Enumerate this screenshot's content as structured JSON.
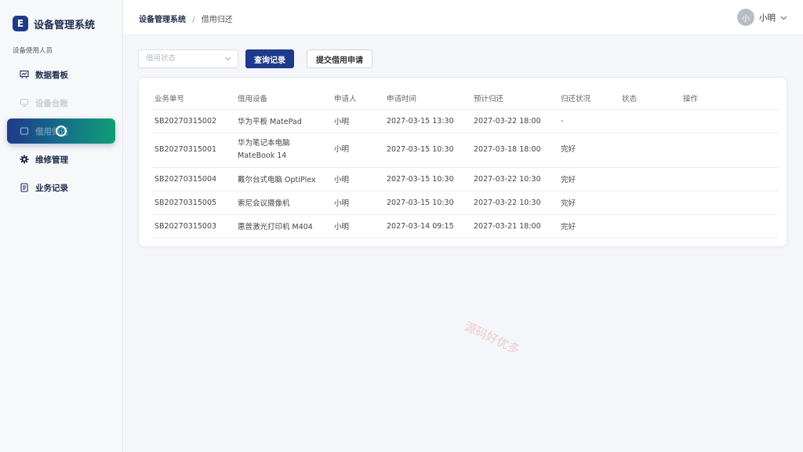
{
  "brand": {
    "logo_letter": "E",
    "title": "设备管理系统"
  },
  "sidebar": {
    "section_label": "设备使用人员",
    "items": [
      {
        "label": "数据看板",
        "icon": "chart-board-icon",
        "state": "normal"
      },
      {
        "label": "设备台账",
        "icon": "monitor-icon",
        "state": "disabled"
      },
      {
        "label": "借用归还",
        "icon": "loading-spinner-icon",
        "state": "active"
      },
      {
        "label": "维修管理",
        "icon": "gear-icon",
        "state": "normal"
      },
      {
        "label": "业务记录",
        "icon": "document-icon",
        "state": "normal"
      }
    ]
  },
  "header": {
    "breadcrumb_root": "设备管理系统",
    "breadcrumb_sep": "/",
    "breadcrumb_current": "借用归还",
    "user_avatar_text": "小",
    "user_name": "小明"
  },
  "toolbar": {
    "status_placeholder": "借用状态",
    "query_label": "查询记录",
    "submit_label": "提交借用申请"
  },
  "table": {
    "columns": [
      "业务单号",
      "借用设备",
      "申请人",
      "申请时间",
      "预计归还",
      "归还状况",
      "状态",
      "操作"
    ],
    "rows": [
      {
        "id": "SB20270315002",
        "device": "华为平板 MatePad",
        "device2": "",
        "applicant": "小明",
        "applied": "2027-03-15 13:30",
        "due": "2027-03-22 18:00",
        "condition": "-",
        "status": "",
        "action": ""
      },
      {
        "id": "SB20270315001",
        "device": "华为笔记本电脑",
        "device2": "MateBook 14",
        "applicant": "小明",
        "applied": "2027-03-15 10:30",
        "due": "2027-03-18 18:00",
        "condition": "完好",
        "status": "",
        "action": ""
      },
      {
        "id": "SB20270315004",
        "device": "戴尔台式电脑 OptiPlex",
        "device2": "",
        "applicant": "小明",
        "applied": "2027-03-15 10:30",
        "due": "2027-03-22 10:30",
        "condition": "完好",
        "status": "",
        "action": ""
      },
      {
        "id": "SB20270315005",
        "device": "索尼会议摄像机",
        "device2": "",
        "applicant": "小明",
        "applied": "2027-03-15 10:30",
        "due": "2027-03-22 10:30",
        "condition": "完好",
        "status": "",
        "action": ""
      },
      {
        "id": "SB20270315003",
        "device": "惠普激光打印机 M404",
        "device2": "",
        "applicant": "小明",
        "applied": "2027-03-14 09:15",
        "due": "2027-03-21 18:00",
        "condition": "完好",
        "status": "",
        "action": ""
      }
    ]
  },
  "watermark": "源码好优多",
  "colors": {
    "primary": "#1e3a8a",
    "accent_gradient_end": "#0e9f73",
    "background": "#f4f6f9"
  }
}
